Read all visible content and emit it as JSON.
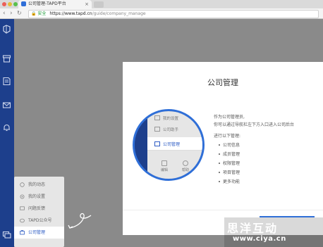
{
  "browser": {
    "tab_title": "公司管理-TAPD平台",
    "tab_close": "×",
    "back": "‹",
    "forward": "›",
    "reload": "↻",
    "secure_label": "安全",
    "url_host": "https://www.tapd.cn",
    "url_path": "/guide/company_manage"
  },
  "rail": {
    "icons": [
      "logo-icon",
      "archive-icon",
      "note-icon",
      "mail-icon",
      "bell-icon",
      "chat-icon"
    ]
  },
  "menu": {
    "items": [
      {
        "label": "我的动态",
        "icon": "activity-icon"
      },
      {
        "label": "我的设置",
        "icon": "settings-icon"
      },
      {
        "label": "问题反馈",
        "icon": "feedback-icon"
      },
      {
        "label": "TAPD公众号",
        "icon": "wechat-icon"
      },
      {
        "label": "公司管理",
        "icon": "company-icon",
        "active": true
      }
    ]
  },
  "card": {
    "title": "公司管理",
    "intro": [
      "作为公司管理员,",
      "你可以通过导航栏左下方入口进入公司后台",
      "进行以下管理:"
    ],
    "list": [
      "公司信息",
      "成员管理",
      "权限管理",
      "项目管理",
      "更多功能"
    ]
  },
  "magnifier": {
    "items": [
      "我的设置",
      "公司助手"
    ],
    "active": "公司管理",
    "bottom": [
      "编辑",
      "帮助"
    ]
  },
  "watermark": {
    "title": "思洋互动",
    "url": "www.ciya.cn"
  },
  "colors": {
    "rail": "#1d3f8c",
    "accent": "#2f6fd8",
    "overlay": "#8a8a8a",
    "active_text": "#2c5bc4"
  }
}
